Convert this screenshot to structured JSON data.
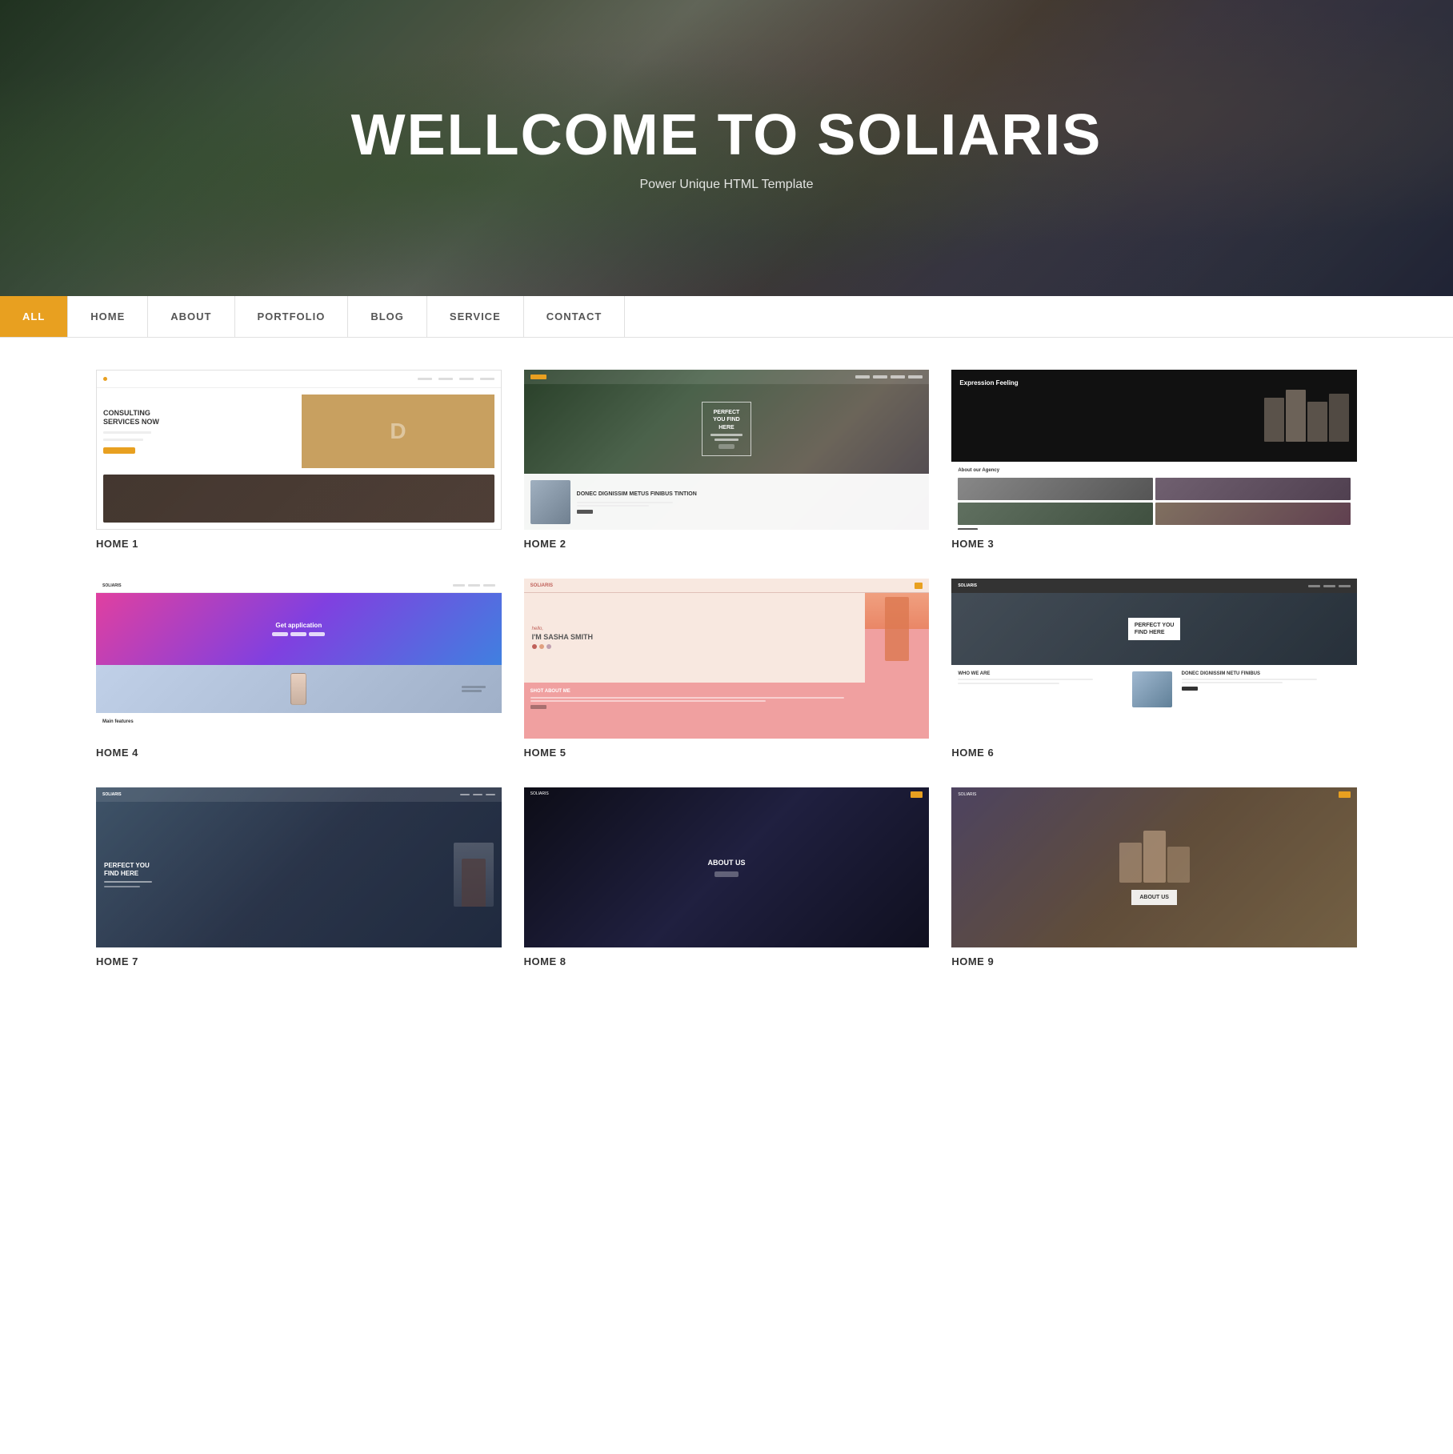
{
  "hero": {
    "title": "WELLCOME TO SOLIARIS",
    "subtitle": "Power Unique HTML Template"
  },
  "nav": {
    "tabs": [
      {
        "label": "ALL",
        "active": true
      },
      {
        "label": "HOME",
        "active": false
      },
      {
        "label": "ABOUT",
        "active": false
      },
      {
        "label": "PORTFOLIO",
        "active": false
      },
      {
        "label": "BLOG",
        "active": false
      },
      {
        "label": "SERVICE",
        "active": false
      },
      {
        "label": "CONTACT",
        "active": false
      }
    ]
  },
  "grid": {
    "rows": [
      [
        {
          "id": "home1",
          "label": "HOME 1"
        },
        {
          "id": "home2",
          "label": "HOME 2"
        },
        {
          "id": "home3",
          "label": "HOME 3"
        }
      ],
      [
        {
          "id": "home4",
          "label": "HOME 4"
        },
        {
          "id": "home5",
          "label": "HOME 5"
        },
        {
          "id": "home6",
          "label": "HOME 6"
        }
      ],
      [
        {
          "id": "home7",
          "label": "HOME 7"
        },
        {
          "id": "home8",
          "label": "HOME 8"
        },
        {
          "id": "home9",
          "label": "HOME 9"
        }
      ]
    ]
  }
}
